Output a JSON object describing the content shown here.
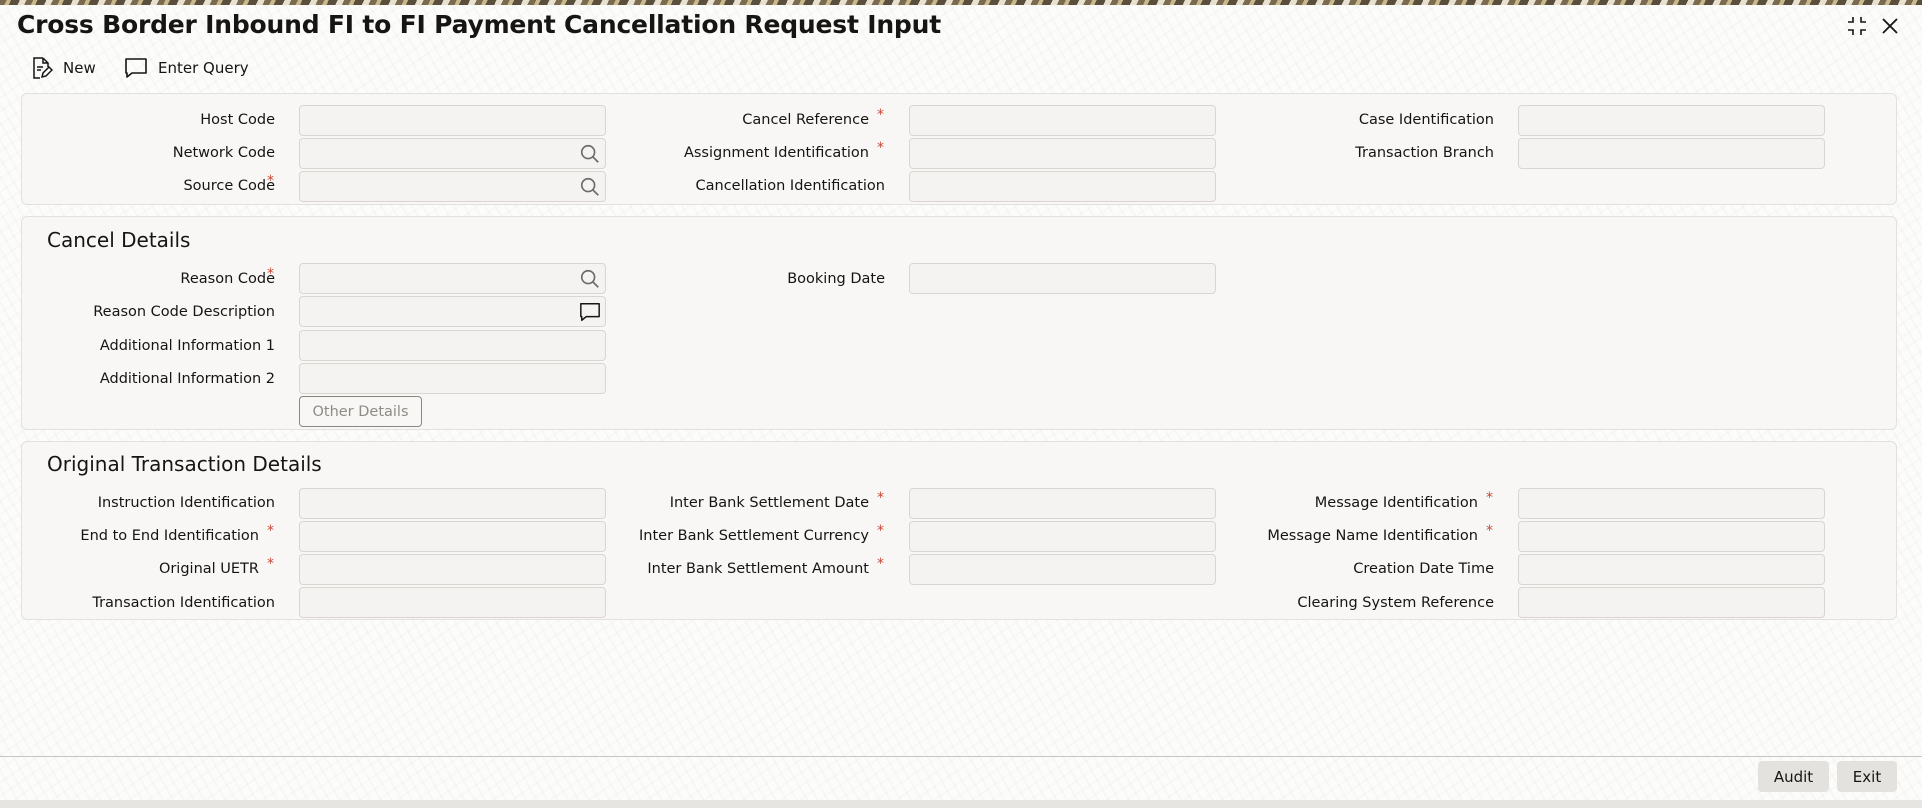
{
  "page": {
    "title": "Cross Border Inbound FI to FI Payment Cancellation Request Input"
  },
  "window_controls": {
    "expand_icon": "expand-arrows-icon",
    "close_icon": "close-icon"
  },
  "toolbar": {
    "new_label": "New",
    "new_icon": "document-edit-icon",
    "enter_query_label": "Enter Query",
    "enter_query_icon": "speech-bubble-icon"
  },
  "header_fields": {
    "host_code": {
      "label": "Host Code",
      "value": ""
    },
    "network_code": {
      "label": "Network Code",
      "value": ""
    },
    "source_code": {
      "label": "Source Code",
      "value": ""
    },
    "cancel_reference": {
      "label": "Cancel Reference",
      "value": ""
    },
    "assignment_identification": {
      "label": "Assignment Identification",
      "value": ""
    },
    "cancellation_identification": {
      "label": "Cancellation Identification",
      "value": ""
    },
    "case_identification": {
      "label": "Case Identification",
      "value": ""
    },
    "transaction_branch": {
      "label": "Transaction Branch",
      "value": ""
    }
  },
  "cancel_details": {
    "title": "Cancel Details",
    "reason_code": {
      "label": "Reason Code",
      "value": ""
    },
    "reason_code_description": {
      "label": "Reason Code Description",
      "value": ""
    },
    "additional_information_1": {
      "label": "Additional Information 1",
      "value": ""
    },
    "additional_information_2": {
      "label": "Additional Information 2",
      "value": ""
    },
    "booking_date": {
      "label": "Booking Date",
      "value": ""
    },
    "other_details_label": "Other Details"
  },
  "original_transaction": {
    "title": "Original Transaction Details",
    "instruction_identification": {
      "label": "Instruction Identification",
      "value": ""
    },
    "end_to_end_identification": {
      "label": "End to End Identification",
      "value": ""
    },
    "original_uetr": {
      "label": "Original UETR",
      "value": ""
    },
    "transaction_identification": {
      "label": "Transaction Identification",
      "value": ""
    },
    "inter_bank_settlement_date": {
      "label": "Inter Bank Settlement Date",
      "value": ""
    },
    "inter_bank_settlement_currency": {
      "label": "Inter Bank Settlement Currency",
      "value": ""
    },
    "inter_bank_settlement_amount": {
      "label": "Inter Bank Settlement Amount",
      "value": ""
    },
    "message_identification": {
      "label": "Message Identification",
      "value": ""
    },
    "message_name_identification": {
      "label": "Message Name Identification",
      "value": ""
    },
    "creation_date_time": {
      "label": "Creation Date Time",
      "value": ""
    },
    "clearing_system_reference": {
      "label": "Clearing System Reference",
      "value": ""
    }
  },
  "required_marker": "*",
  "footer": {
    "audit_label": "Audit",
    "exit_label": "Exit"
  },
  "colors": {
    "required": "#c74634",
    "panel_background": "#f8f7f5",
    "field_background": "#f4f3f1"
  }
}
